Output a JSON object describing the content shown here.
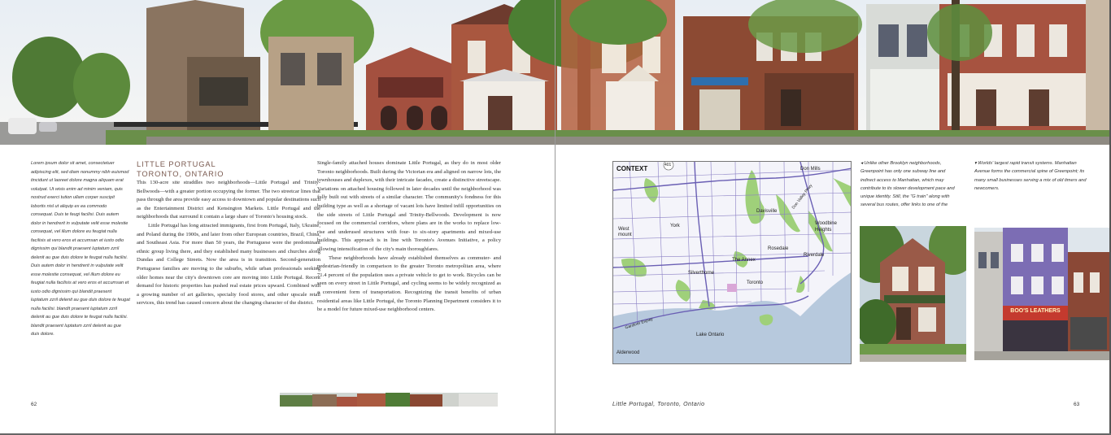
{
  "left_page": {
    "sidebar_text": "Lorem ipsum dolor sit amet, consectetuer adipiscing elit, sed diam nonummy nibh euismod tincidunt ut laoreet dolore magna aliquam erat volutpat. Ut wisis enim ad minim veniam, quis nostrud exerci tution ullam corper suscipit lobortis nisl ut aliquip ex ea commodo consequat. Duis te feugi facilisi. Duis autem dolor in hendrerit in vulputate velit esse molestie consequat, vel illum dolore eu feugiat nulla facilisis at vero eros et accumsan et iusto odio dignissim qui blandit praesent luptatum zzril delenit au gue duis dolore te feugat nulla facilisi. Duis autem dolor in hendrerit in vulputate velit esse molestie consequat, vel illum dolore eu feugiat nulla facilisis at vero eros et accumsan et iusto odio dignissim qui blandit praesent luptatum zzril delenit au gue duis dolore te feugat nulla facilisi. blandit praesent luptatum zzril delenit au gue duis dolore te feugat nulla facilisi. blandit praesent luptatum zzril delenit au gue duis dolore.",
    "heading_line1": "LITTLE PORTUGAL",
    "heading_line2": "TORONTO, ONTARIO",
    "col1_p1": "This 130-acre site straddles two neighborhoods—Little Portugal and Trinity-Bellwoods—with a greater portion occupying the former. The two streetcar lines that pass through the area provide easy access to downtown and popular destinations such as the Entertainment District and Kensington Markets. Little Portugal and the neighborhoods that surround it contain a large share of Toronto's housing stock.",
    "col1_p2": "Little Portugal has long attracted immigrants, first from Portugal, Italy, Ukraine, and Poland during the 1900s, and later from other European countries, Brazil, China, and Southeast Asia. For more than 50 years, the Portuguese were the predominant ethnic group living there, and they established many businesses and churches along Dundas and College Streets. Now the area is in transition. Second-generation Portuguese families are moving to the suburbs, while urban professionals seeking older homes near the city's downtown core are moving into Little Portugal. Recent demand for historic properties has pushed real estate prices upward. Combined with a growing number of art galleries, specialty food stores, and other upscale retail services, this trend has caused concern about the changing character of the district.",
    "col2_p1": "Single-family attached houses dominate Little Portugal, as they do in most older Toronto neighborhoods. Built during the Victorian era and aligned on narrow lots, the townhouses and duplexes, with their intricate facades, create a distinctive streetscape. Variations on attached housing followed in later decades until the neighborhood was fully built out with streets of a similar character. The community's fondness for this building type as well as a shortage of vacant lots have limited infill opportunities on the side streets of Little Portugal and Trinity-Bellwoods. Development is now focused on the commercial corridors, where plans are in the works to replace low-rise and underused structures with four- to six-story apartments and mixed-use buildings. This approach is in line with Toronto's Avenues Initiative, a policy allowing intensification of the city's main thoroughfares.",
    "col2_p2": "These neighborhoods have already established themselves as commuter- and pedestrian-friendly in comparison to the greater Toronto metropolitan area, where 71.4 percent of the population uses a private vehicle to get to work. Bicycles can be seen on every street in Little Portugal, and cycling seems to be widely recognized as a convenient form of transportation. Recognizing the transit benefits of urban residential areas like Little Portugal, the Toronto Planning Department considers it to be a model for future mixed-use neighborhood centers.",
    "page_number": "62"
  },
  "right_page": {
    "map": {
      "title": "CONTEXT",
      "labels": {
        "don_mills": "Don Mills",
        "hwy401": "401",
        "davisville": "Davisville",
        "york": "York",
        "west_mount": "West mount",
        "woodbine_heights": "Woodbine Heights",
        "rosedale": "Rosedale",
        "the_annex": "The Annex",
        "riverdale": "Riverdale",
        "silverthorne": "Silverthorne",
        "toronto": "Toronto",
        "gardiner": "Gardiner Expwy",
        "lake_ontario": "Lake Ontario",
        "alderwood": "Alderwood",
        "don_valley": "Don Valley Pkwy"
      },
      "colors": {
        "land": "#f4f4fa",
        "water": "#b7c9dd",
        "park": "#9fd07a",
        "road": "#8a7fc4",
        "site": "#d9a7d7"
      }
    },
    "caption1": "◂ Unlike other Brooklyn neighborhoods, Greenpoint has only one subway line and indirect access to Manhattan, which may contribute to its slower development pace and unique identity. Still, the \"G train\" along with several bus routes, offer links to one of the",
    "caption2": "▾ Worlds' largest rapid transit systems. Manhattan Avenue forms the commercial spine of Greenpoint; its many small businesses serving a mix of old timers and newcomers.",
    "storefront_sign": "BOO'S LEATHERS",
    "running_foot": "Little Portugal, Toronto, Ontario",
    "page_number": "63"
  }
}
